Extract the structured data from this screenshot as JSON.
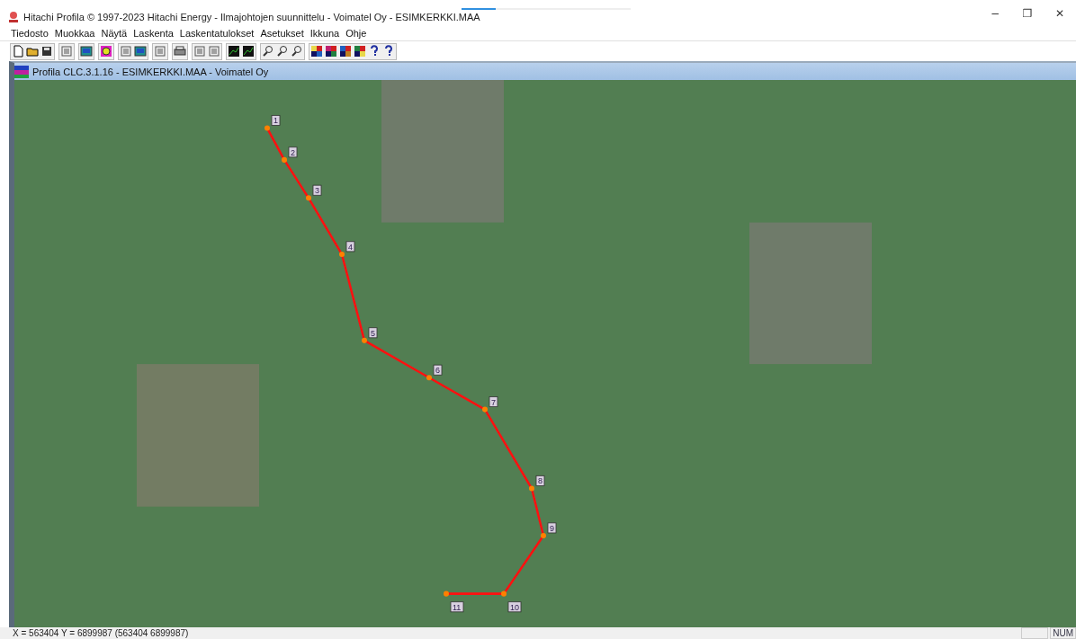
{
  "window": {
    "title": "Hitachi Profila © 1997-2023 Hitachi Energy - Ilmajohtojen suunnittelu - Voimatel Oy - ESIMKERKKI.MAA",
    "controls": [
      "−",
      "❐",
      "✕"
    ]
  },
  "loading_bar": {
    "level": 0.2
  },
  "menu": [
    "Tiedosto",
    "Muokkaa",
    "Näytä",
    "Laskenta",
    "Laskentatulokset",
    "Asetukset",
    "Ikkuna",
    "Ohje"
  ],
  "document_window": {
    "title": "Profila CLC.3.1.16  - ESIMKERKKI.MAA - Voimatel Oy"
  },
  "map": {
    "nodes": [
      {
        "label": "1"
      },
      {
        "label": "2"
      },
      {
        "label": "3"
      },
      {
        "label": "4"
      },
      {
        "label": "5"
      },
      {
        "label": "6"
      },
      {
        "label": "7"
      },
      {
        "label": "8"
      },
      {
        "label": "9"
      },
      {
        "label": "10"
      },
      {
        "label": "11"
      }
    ]
  },
  "status_bar": {
    "coordinates": "X = 563404  Y = 6899987 (563404 6899987)",
    "indicators": [
      "NUM"
    ]
  }
}
